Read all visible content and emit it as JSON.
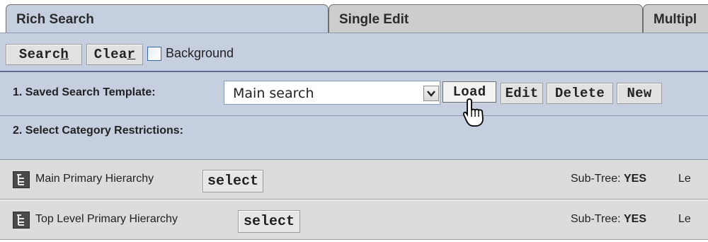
{
  "tabs": [
    {
      "label": "Rich Search",
      "active": true
    },
    {
      "label": "Single Edit",
      "active": false
    },
    {
      "label": "Multipl",
      "active": false
    }
  ],
  "toolbar": {
    "search_pre": "Searc",
    "search_ul": "h",
    "clear_pre": "Clea",
    "clear_ul": "r",
    "background_label": "Background",
    "background_checked": false
  },
  "template": {
    "label": "1. Saved Search Template:",
    "selected": "Main search",
    "load": "Load",
    "edit": "Edit",
    "delete": "Delete",
    "new": "New"
  },
  "category": {
    "label": "2. Select Category Restrictions:"
  },
  "hierarchies": [
    {
      "name": "Main Primary Hierarchy",
      "select": "select",
      "subtree_label": "Sub-Tree:",
      "subtree_value": "YES",
      "level_label": "Le"
    },
    {
      "name": "Top Level Primary Hierarchy",
      "select": "select",
      "subtree_label": "Sub-Tree:",
      "subtree_value": "YES",
      "level_label": "Le"
    }
  ],
  "icons": {
    "dropdown": "chevron-down-icon",
    "hierarchy": "tree-icon",
    "cursor": "hand-pointer-icon"
  },
  "colors": {
    "panel": "#c5cfe0",
    "row": "#dcdcdc",
    "tab_inactive": "#cdcdcd"
  }
}
